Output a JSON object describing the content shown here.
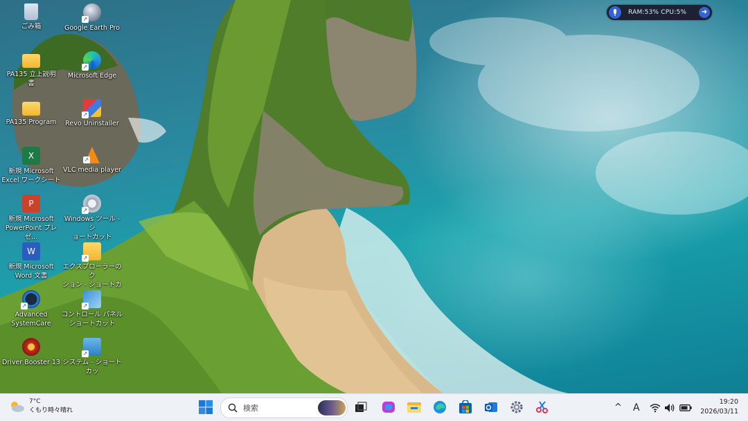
{
  "desktop_icons": [
    {
      "label": "ごみ箱",
      "icon": "recycle-bin-icon"
    },
    {
      "label": "Google Earth Pro",
      "icon": "google-earth-icon"
    },
    {
      "label": "PA135 立上説明\n書",
      "icon": "folder-icon"
    },
    {
      "label": "Microsoft Edge",
      "icon": "edge-icon"
    },
    {
      "label": "PA135 Program",
      "icon": "folder-icon"
    },
    {
      "label": "Revo Uninstaller",
      "icon": "revo-uninstaller-icon"
    },
    {
      "label": "新規 Microsoft\nExcel ワークシート",
      "icon": "excel-icon"
    },
    {
      "label": "VLC media player",
      "icon": "vlc-icon"
    },
    {
      "label": "新規 Microsoft\nPowerPoint プレゼ...",
      "icon": "powerpoint-icon"
    },
    {
      "label": "Windows ツール - シ\nョートカット",
      "icon": "windows-tools-icon"
    },
    {
      "label": "新規 Microsoft\nWord 文書",
      "icon": "word-icon"
    },
    {
      "label": "エクスプローラーのク\nション - ショートカ",
      "icon": "explorer-folder-icon"
    },
    {
      "label": "Advanced\nSystemCare",
      "icon": "advanced-systemcare-icon"
    },
    {
      "label": "コントロール パネル\nショートカット",
      "icon": "control-panel-icon"
    },
    {
      "label": "Driver Booster 13",
      "icon": "driver-booster-icon"
    },
    {
      "label": "システム - ショートカッ",
      "icon": "system-icon"
    }
  ],
  "monitor": {
    "text": "RAM:53%  CPU:5%"
  },
  "taskbar": {
    "weather": {
      "temp": "7°C",
      "condition": "くもり時々晴れ"
    },
    "search_placeholder": "検索",
    "apps": [
      "start-icon",
      "task-view-icon",
      "copilot-icon",
      "file-explorer-icon",
      "edge-icon",
      "microsoft-store-icon",
      "outlook-icon",
      "settings-icon",
      "snipping-tool-icon"
    ],
    "tray": {
      "chevron": "^",
      "ime": "A"
    },
    "time": "19:20",
    "date": "2026/03/11"
  }
}
